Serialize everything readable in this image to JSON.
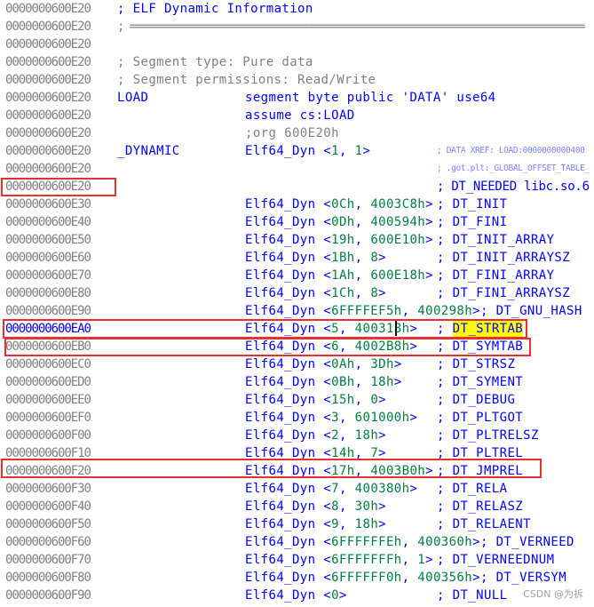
{
  "colors": {
    "address": "#808080",
    "selected_address": "#0000ff",
    "code": "#0000ff",
    "number": "#008040",
    "comment_gray": "#808080",
    "xref": "#8080ff",
    "highlight": "#ffff00",
    "annotation_box": "#e8312f"
  },
  "rows": [
    {
      "addr": "0000000600E20",
      "label_comment": "; ELF Dynamic Information",
      "label_comment_style": "blue"
    },
    {
      "addr": "0000000600E20",
      "label_comment": "; ===========================================================================",
      "label_comment_style": "gray"
    },
    {
      "addr": "0000000600E20"
    },
    {
      "addr": "0000000600E20",
      "label_comment": "; Segment type: Pure data",
      "label_comment_style": "gray"
    },
    {
      "addr": "0000000600E20",
      "label_comment": "; Segment permissions: Read/Write",
      "label_comment_style": "gray"
    },
    {
      "addr": "0000000600E20",
      "label": "LOAD",
      "code": "segment byte public 'DATA' use64"
    },
    {
      "addr": "0000000600E20",
      "code": "assume cs:LOAD"
    },
    {
      "addr": "0000000600E20",
      "code": ";org 600E20h",
      "code_style": "gray"
    },
    {
      "addr": "0000000600E20",
      "label": "_DYNAMIC",
      "op": "Elf64_Dyn",
      "args": [
        "1",
        "1"
      ],
      "comment": "; DATA XREF: LOAD:0000000000400",
      "comment_style": "xref",
      "comment_col": true
    },
    {
      "addr": "0000000600E20",
      "comment": "; .got.plt:_GLOBAL_OFFSET_TABLE_",
      "comment_style": "xref",
      "comment_col": true
    },
    {
      "addr": "0000000600E20",
      "comment": "; DT_NEEDED libc.so.6",
      "comment_col": true
    },
    {
      "addr": "0000000600E30",
      "op": "Elf64_Dyn",
      "args": [
        "0Ch",
        "4003C8h"
      ],
      "comment": "; DT_INIT"
    },
    {
      "addr": "0000000600E40",
      "op": "Elf64_Dyn",
      "args": [
        "0Dh",
        "400594h"
      ],
      "comment": "; DT_FINI"
    },
    {
      "addr": "0000000600E50",
      "op": "Elf64_Dyn",
      "args": [
        "19h",
        "600E10h"
      ],
      "comment": "; DT_INIT_ARRAY"
    },
    {
      "addr": "0000000600E60",
      "op": "Elf64_Dyn",
      "args": [
        "1Bh",
        "8"
      ],
      "comment": "; DT_INIT_ARRAYSZ"
    },
    {
      "addr": "0000000600E70",
      "op": "Elf64_Dyn",
      "args": [
        "1Ah",
        "600E18h"
      ],
      "comment": "; DT_FINI_ARRAY"
    },
    {
      "addr": "0000000600E80",
      "op": "Elf64_Dyn",
      "args": [
        "1Ch",
        "8"
      ],
      "comment": "; DT_FINI_ARRAYSZ"
    },
    {
      "addr": "0000000600E90",
      "op": "Elf64_Dyn",
      "args": [
        "6FFFFEF5h",
        "400298h"
      ],
      "comment": "; DT_GNU_HASH"
    },
    {
      "addr": "0000000600EA0",
      "selected": true,
      "op": "Elf64_Dyn",
      "args": [
        "5",
        "400318h"
      ],
      "comment": "; ",
      "comment_hl": "DT_STRTAB"
    },
    {
      "addr": "0000000600EB0",
      "op": "Elf64_Dyn",
      "args": [
        "6",
        "4002B8h"
      ],
      "comment": "; DT_SYMTAB"
    },
    {
      "addr": "0000000600EC0",
      "op": "Elf64_Dyn",
      "args": [
        "0Ah",
        "3Dh"
      ],
      "comment": "; DT_STRSZ"
    },
    {
      "addr": "0000000600ED0",
      "op": "Elf64_Dyn",
      "args": [
        "0Bh",
        "18h"
      ],
      "comment": "; DT_SYMENT"
    },
    {
      "addr": "0000000600EE0",
      "op": "Elf64_Dyn",
      "args": [
        "15h",
        "0"
      ],
      "comment": "; DT_DEBUG"
    },
    {
      "addr": "0000000600EF0",
      "op": "Elf64_Dyn",
      "args": [
        "3",
        "601000h"
      ],
      "comment": "; DT_PLTGOT"
    },
    {
      "addr": "0000000600F00",
      "op": "Elf64_Dyn",
      "args": [
        "2",
        "18h"
      ],
      "comment": "; DT_PLTRELSZ"
    },
    {
      "addr": "0000000600F10",
      "op": "Elf64_Dyn",
      "args": [
        "14h",
        "7"
      ],
      "comment": "; DT_PLTREL"
    },
    {
      "addr": "0000000600F20",
      "op": "Elf64_Dyn",
      "args": [
        "17h",
        "4003B0h"
      ],
      "comment": "; DT_JMPREL"
    },
    {
      "addr": "0000000600F30",
      "op": "Elf64_Dyn",
      "args": [
        "7",
        "400380h"
      ],
      "comment": "; DT_RELA"
    },
    {
      "addr": "0000000600F40",
      "op": "Elf64_Dyn",
      "args": [
        "8",
        "30h"
      ],
      "comment": "; DT_RELASZ"
    },
    {
      "addr": "0000000600F50",
      "op": "Elf64_Dyn",
      "args": [
        "9",
        "18h"
      ],
      "comment": "; DT_RELAENT"
    },
    {
      "addr": "0000000600F60",
      "op": "Elf64_Dyn",
      "args": [
        "6FFFFFFEh",
        "400360h"
      ],
      "comment": "; DT_VERNEED"
    },
    {
      "addr": "0000000600F70",
      "op": "Elf64_Dyn",
      "args": [
        "6FFFFFFFh",
        "1"
      ],
      "comment": "; DT_VERNEEDNUM"
    },
    {
      "addr": "0000000600F80",
      "op": "Elf64_Dyn",
      "args": [
        "6FFFFFF0h",
        "400356h"
      ],
      "comment": "; DT_VERSYM"
    },
    {
      "addr": "0000000600F90",
      "op": "Elf64_Dyn",
      "args": [
        "0"
      ],
      "comment": "; DT_NULL"
    }
  ],
  "watermark": "CSDN @为拆"
}
